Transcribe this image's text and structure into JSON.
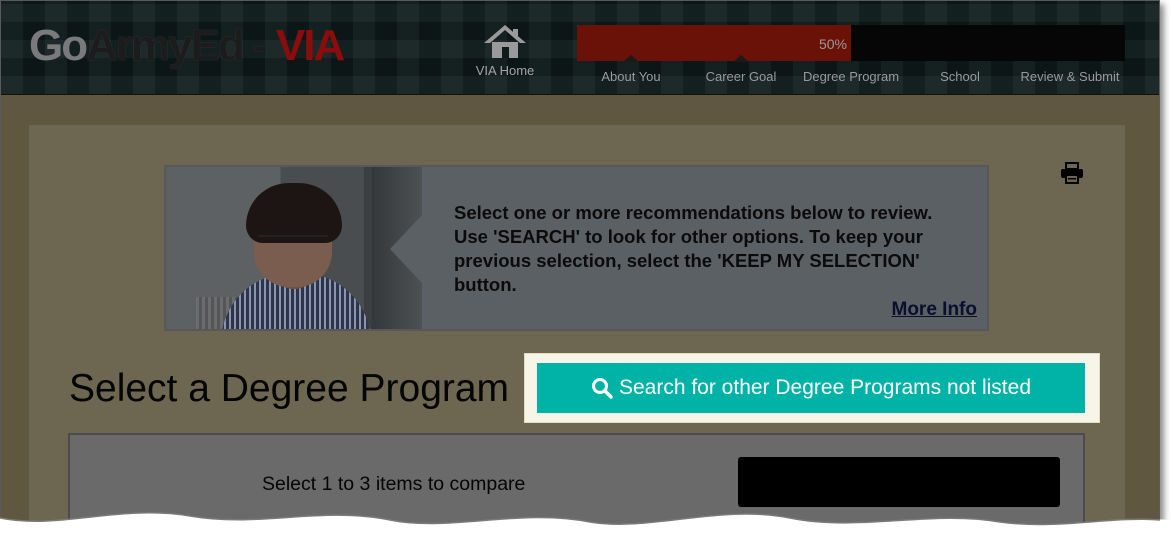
{
  "header": {
    "logo": {
      "part1": "Go",
      "part2": "ArmyEd",
      "sep": " - ",
      "part3": "VIA"
    },
    "home_label": "VIA Home",
    "progress": {
      "percent": 0.5,
      "label": "50%"
    },
    "steps": [
      {
        "label": "About You"
      },
      {
        "label": "Career Goal"
      },
      {
        "label": "Degree Program"
      },
      {
        "label": "School"
      },
      {
        "label": "Review & Submit"
      }
    ]
  },
  "info": {
    "text": "Select one or more recommendations below to review. Use 'SEARCH' to look for other options. To keep your previous selection, select the 'KEEP MY SELECTION' button.",
    "more_info": "More Info"
  },
  "page_title": "Select a Degree Program",
  "search_button_label": "Search for other Degree Programs not listed",
  "compare": {
    "text": "Select 1 to 3 items to compare",
    "button_label": ""
  },
  "colors": {
    "accent": "#00b3a6",
    "progress_fill": "#6b1208",
    "overlay_bg": "#6d6650"
  },
  "icons": {
    "home": "home-icon",
    "print": "print-icon",
    "search": "search-icon"
  }
}
